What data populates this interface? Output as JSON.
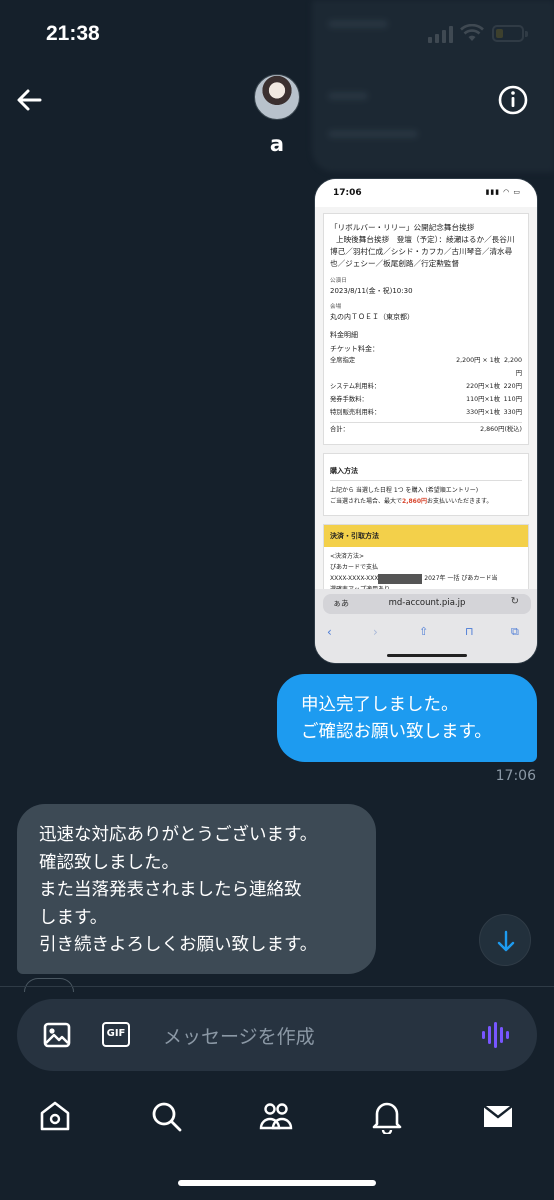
{
  "status_bar": {
    "time": "21:38",
    "icons": [
      "signal-icon",
      "wifi-icon",
      "battery-icon"
    ]
  },
  "header": {
    "contact_name": "a",
    "back_icon": "arrow-left-icon",
    "info_icon": "info-icon"
  },
  "shared_screenshot": {
    "status_time": "17:06",
    "title_lines": [
      "「リボルバー・リリー」公開記念舞台挨拶",
      "上映後舞台挨拶　登壇（予定）：綾瀬はるか／長谷川",
      "博己／羽村仁成／シシド・カフカ／古川琴音／清水尋",
      "也／ジェシー／板尾創路／行定勲監督"
    ],
    "date_label": "公演日",
    "date_value": "2023/8/11(金・祝)10:30",
    "venue_label": "会場",
    "venue_value": "丸の内ＴＯＥＩ（東京都）",
    "fee_heading": "料金明細",
    "ticket_label": "チケット料金：",
    "fee_rows": [
      {
        "name": "全席指定",
        "unit": "2,200円 × 1枚",
        "amount": "2,200円"
      },
      {
        "name": "システム利用料：",
        "unit": "220円×1枚",
        "amount": "220円"
      },
      {
        "name": "発券手数料：",
        "unit": "110円×1枚",
        "amount": "110円"
      },
      {
        "name": "特別販売利用料：",
        "unit": "330円×1枚",
        "amount": "330円"
      }
    ],
    "total_label": "合計：",
    "total_value": "2,860円(税込)",
    "purchase_heading": "購入方法",
    "purchase_line1": "上記から 当選した日程 1つ を購入 (希望順エントリー)",
    "purchase_line2_pre": "ご当選された場合、最大で",
    "purchase_line2_amount": "2,860円",
    "purchase_line2_post": "お支払いいただきます。",
    "payment_heading": "決済・引取方法",
    "payment_label": "<決済方法>",
    "payment_line1": "ぴあカードで支払",
    "payment_card_prefix": "XXXX-XXXX-XXX",
    "payment_card_suffix": "2027年 一括 ぴあカード当",
    "payment_line3": "選確率アップ適用あり",
    "url_aa": "ぁあ",
    "url": "md-account.pia.jp"
  },
  "messages": {
    "outgoing_lines": [
      "申込完了しました。",
      "ご確認お願い致します。"
    ],
    "outgoing_time": "17:06",
    "incoming_lines": [
      "迅速な対応ありがとうございます。",
      "確認致しました。",
      "また当落発表されましたら連絡致",
      "します。",
      "引き続きよろしくお願い致します。"
    ]
  },
  "composer": {
    "placeholder": "メッセージを作成",
    "gif_label": "GIF"
  },
  "tabbar": {
    "items": [
      "home-icon",
      "search-icon",
      "communities-icon",
      "notifications-icon",
      "messages-icon"
    ]
  },
  "colors": {
    "background": "#15202b",
    "outgoing_bubble": "#1d9bf0",
    "incoming_bubble": "#3d4a55",
    "accent": "#1d9bf0",
    "voice": "#7856ff"
  }
}
